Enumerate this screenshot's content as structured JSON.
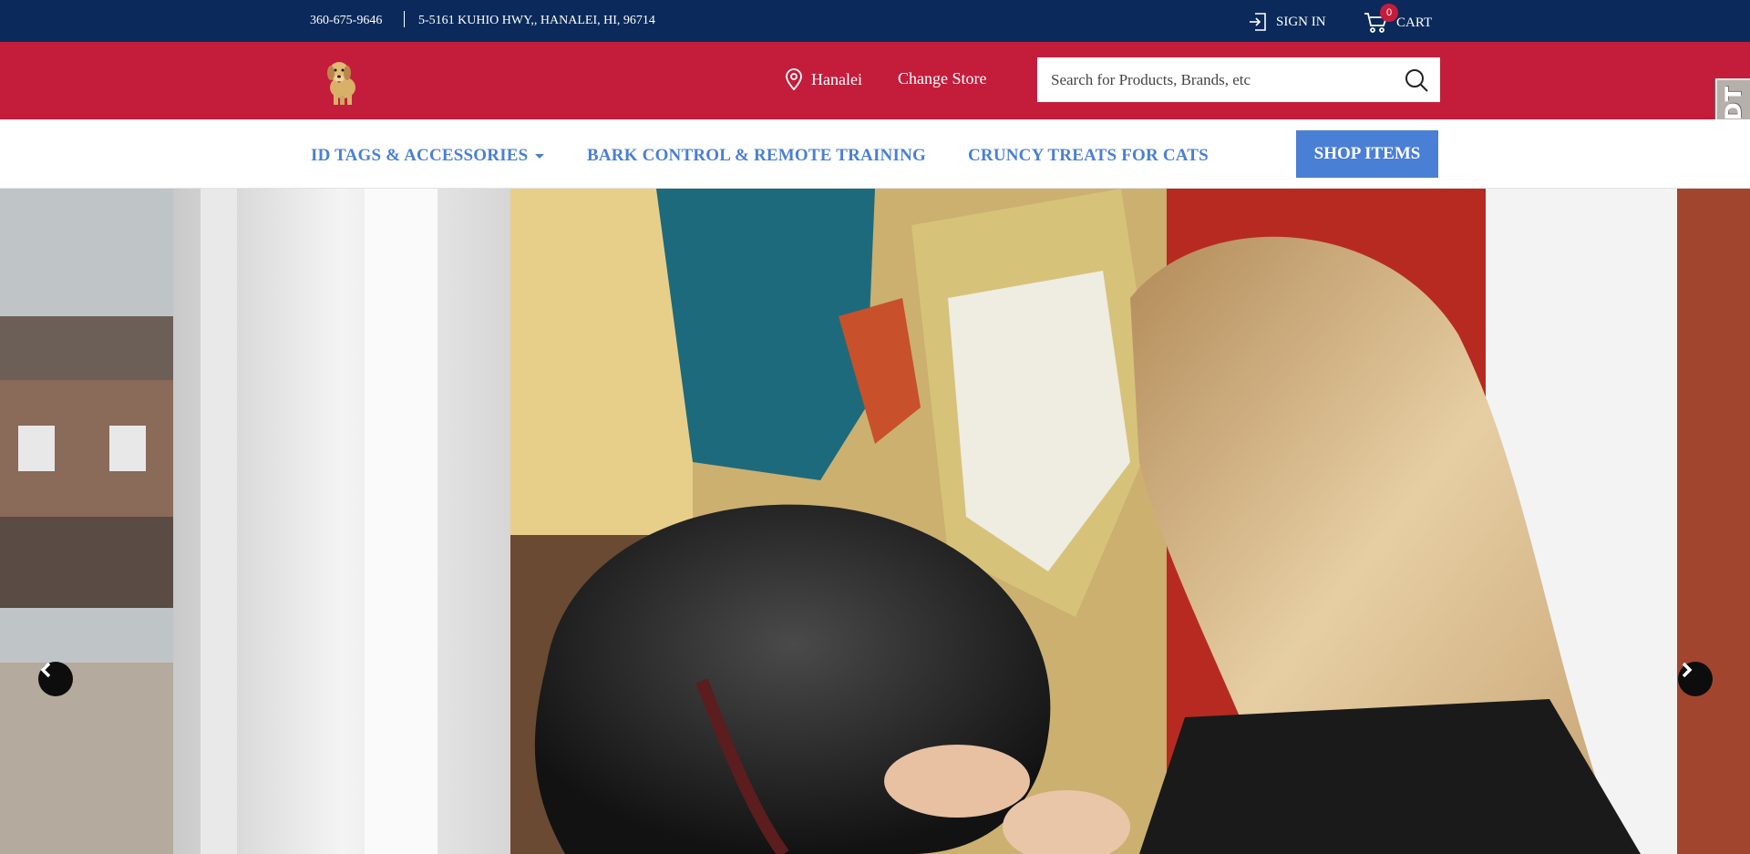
{
  "topbar": {
    "phone": "360-675-9646",
    "address": "5-5161 KUHIO HWY,, HANALEI, HI, 96714",
    "signin_label": "SIGN IN",
    "cart_label": "CART",
    "cart_count": "0"
  },
  "header": {
    "store_name": "Hanalei",
    "change_store_label": "Change Store",
    "search_placeholder": "Search for Products, Brands, etc",
    "side_badge_text": "DDT",
    "logo_icon": "dog-logo-icon"
  },
  "nav": {
    "items": [
      {
        "label": "ID TAGS & ACCESSORIES",
        "has_dropdown": true
      },
      {
        "label": "BARK CONTROL & REMOTE TRAINING",
        "has_dropdown": false
      },
      {
        "label": "CRUNCY TREATS FOR CATS",
        "has_dropdown": false
      }
    ],
    "shop_button_label": "SHOP ITEMS"
  },
  "hero": {
    "prev_icon": "chevron-left-icon",
    "next_icon": "chevron-right-icon"
  },
  "colors": {
    "topbar": "#0b2a5b",
    "header": "#c41d3b",
    "nav_text": "#4a7fd6",
    "shop_button": "#4a7fd6"
  }
}
